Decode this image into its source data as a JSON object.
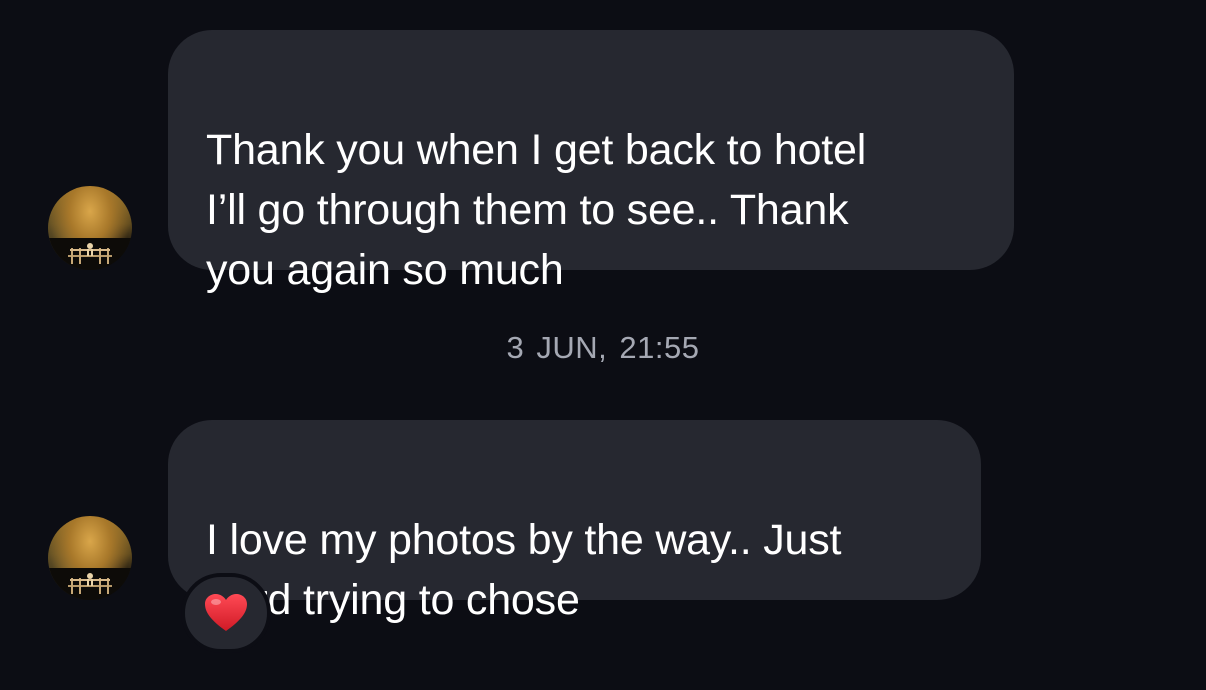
{
  "messages": [
    {
      "text": "Thank you when I get back to hotel\nI’ll go through them to see.. Thank\nyou again so much",
      "avatar_icon": "avatar-photo-icon"
    },
    {
      "text": "I love my photos by the way.. Just\nhard trying to chose",
      "avatar_icon": "avatar-photo-icon",
      "reaction": "❤️"
    }
  ],
  "timestamp": "3 JUN, 21:55",
  "colors": {
    "background": "#0c0d14",
    "bubble": "#262830",
    "timestamp": "#a5a8b3",
    "text": "#ffffff",
    "reaction_heart": "#e0242f"
  }
}
